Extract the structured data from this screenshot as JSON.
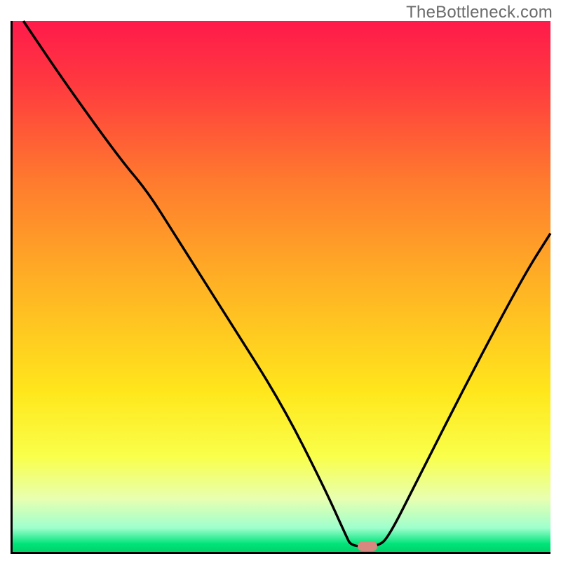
{
  "watermark": "TheBottleneck.com",
  "chart_data": {
    "type": "line",
    "title": "",
    "xlabel": "",
    "ylabel": "",
    "xlim": [
      0,
      100
    ],
    "ylim": [
      0,
      100
    ],
    "grid": false,
    "legend": false,
    "background_gradient": {
      "stops": [
        {
          "pos": 0.0,
          "color": "#ff1a4b"
        },
        {
          "pos": 0.12,
          "color": "#ff3a3f"
        },
        {
          "pos": 0.3,
          "color": "#ff7a2e"
        },
        {
          "pos": 0.5,
          "color": "#ffb324"
        },
        {
          "pos": 0.7,
          "color": "#ffe71c"
        },
        {
          "pos": 0.82,
          "color": "#f9ff4a"
        },
        {
          "pos": 0.9,
          "color": "#e8ffb0"
        },
        {
          "pos": 0.955,
          "color": "#9effcd"
        },
        {
          "pos": 0.985,
          "color": "#00e47a"
        },
        {
          "pos": 1.0,
          "color": "#00d268"
        }
      ]
    },
    "series": [
      {
        "name": "bottleneck-curve",
        "color": "#000000",
        "x": [
          2,
          10,
          20,
          25,
          30,
          40,
          50,
          58,
          62,
          63,
          68,
          70,
          75,
          85,
          95,
          100
        ],
        "y": [
          100,
          88,
          74,
          68,
          60,
          44,
          28,
          12,
          3,
          1,
          1,
          3,
          13,
          33,
          52,
          60
        ]
      }
    ],
    "marker": {
      "x": 66,
      "y": 1,
      "color": "#d98880"
    }
  }
}
